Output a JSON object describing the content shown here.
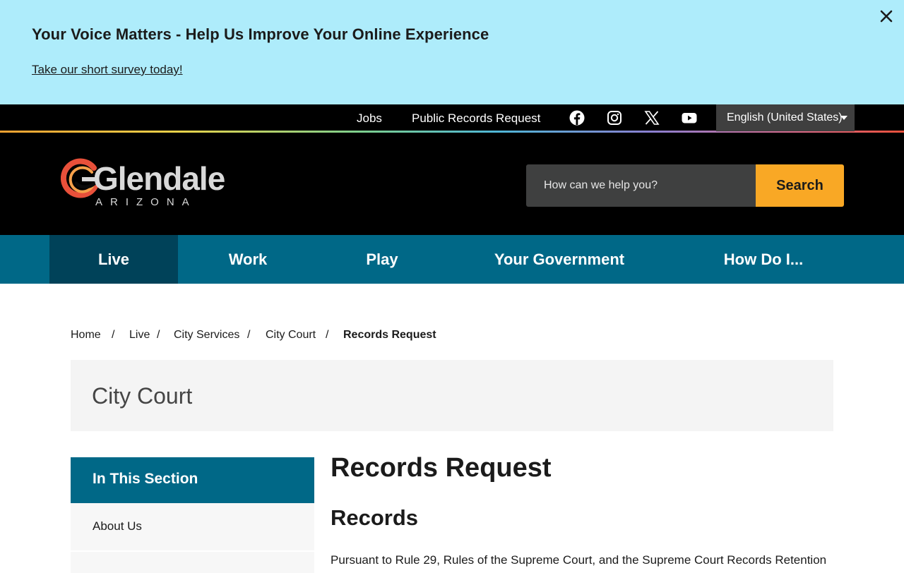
{
  "banner": {
    "title": "Your Voice Matters - Help Us Improve Your Online Experience",
    "link": "Take our short survey today!",
    "close_icon": "close-icon"
  },
  "utility": {
    "links": [
      "Jobs",
      "Public Records Request"
    ],
    "social_icons": [
      "facebook-icon",
      "instagram-icon",
      "x-icon",
      "youtube-icon"
    ],
    "language": "English (United States)"
  },
  "header": {
    "logo_word": "Glendale",
    "logo_sub": "ARIZONA",
    "search_placeholder": "How can we help you?",
    "search_button": "Search"
  },
  "nav": {
    "items": [
      "Live",
      "Work",
      "Play",
      "Your Government",
      "How Do I..."
    ],
    "active": "Live"
  },
  "breadcrumb": {
    "items": [
      "Home",
      "Live",
      "City Services",
      "City Court"
    ],
    "current": "Records Request",
    "separator": "/"
  },
  "section": {
    "title": "City Court"
  },
  "sidebar": {
    "heading": "In This Section",
    "items": [
      "About Us"
    ]
  },
  "content": {
    "title": "Records Request",
    "subtitle": "Records",
    "paragraph": "Pursuant to Rule 29, Rules of the Supreme Court, and the Supreme Court Records Retention"
  },
  "colors": {
    "banner": "#aeecfb",
    "nav": "#006887",
    "nav_active": "#004259",
    "search_button": "#f9a825",
    "logo_accent": "#e8503a"
  }
}
